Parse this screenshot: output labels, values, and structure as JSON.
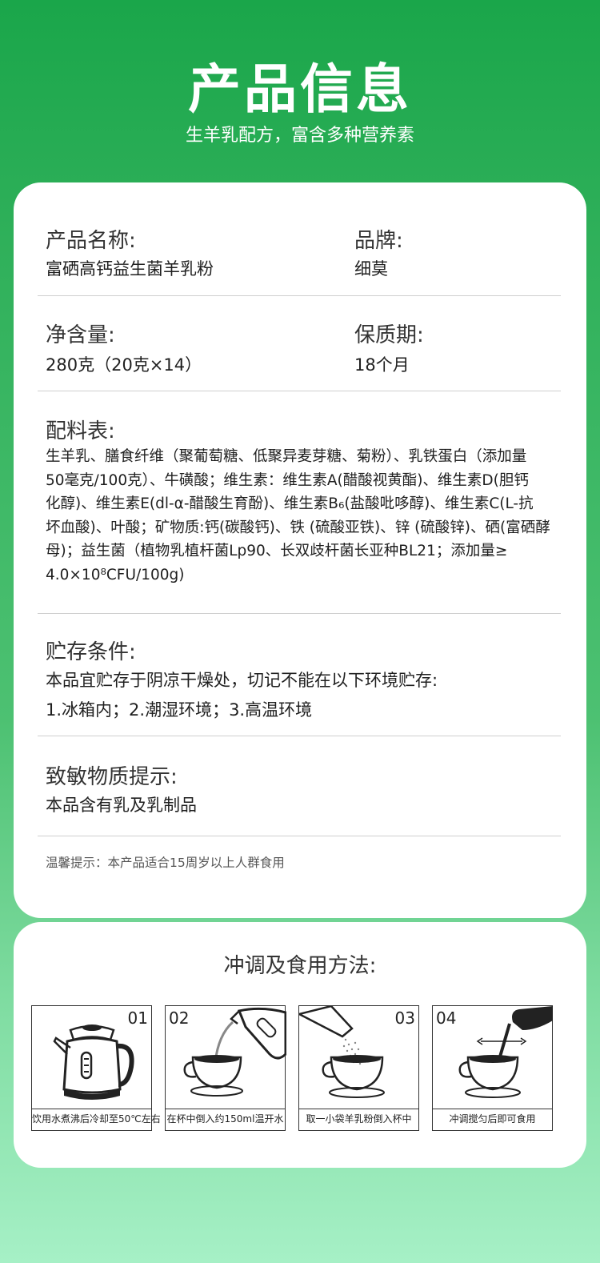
{
  "header": {
    "title": "产品信息",
    "subtitle": "生羊乳配方，富含多种营养素"
  },
  "info": {
    "product_name_label": "产品名称:",
    "product_name": "富硒高钙益生菌羊乳粉",
    "brand_label": "品牌:",
    "brand": "细莫",
    "net_content_label": "净含量:",
    "net_content": "280克（20克×14）",
    "shelf_life_label": "保质期:",
    "shelf_life": "18个月",
    "ingredients_label": "配料表:",
    "ingredients_lines": [
      "生羊乳、膳食纤维（聚葡萄糖、低聚异麦芽糖、菊粉）、乳铁蛋白（添加量",
      "50毫克/100克）、牛磺酸；维生素：维生素A(醋酸视黄酯)、维生素D(胆钙",
      "化醇)、维生素E(dl-α-醋酸生育酚)、维生素B₆(盐酸吡哆醇)、维生素C(L-抗",
      "坏血酸)、叶酸；矿物质:钙(碳酸钙)、铁 (硫酸亚铁)、锌 (硫酸锌)、硒(富硒酵",
      "母)；益生菌（植物乳植杆菌Lp90、长双歧杆菌长亚种BL21；添加量≥",
      "4.0×10⁸CFU/100g)"
    ],
    "storage_label": "贮存条件:",
    "storage_line1": "本品宜贮存于阴凉干燥处，切记不能在以下环境贮存:",
    "storage_line2": "1.冰箱内；2.潮湿环境；3.高温环境",
    "allergen_label": "致敏物质提示:",
    "allergen": "本品含有乳及乳制品",
    "warm_tip": "温馨提示：本产品适合15周岁以上人群食用"
  },
  "method": {
    "title": "冲调及食用方法:",
    "steps": [
      {
        "num": "01",
        "caption": "饮用水煮沸后冷却至50℃左右"
      },
      {
        "num": "02",
        "caption": "在杯中倒入约150ml温开水"
      },
      {
        "num": "03",
        "caption": "取一小袋羊乳粉倒入杯中"
      },
      {
        "num": "04",
        "caption": "冲调搅匀后即可食用"
      }
    ]
  }
}
